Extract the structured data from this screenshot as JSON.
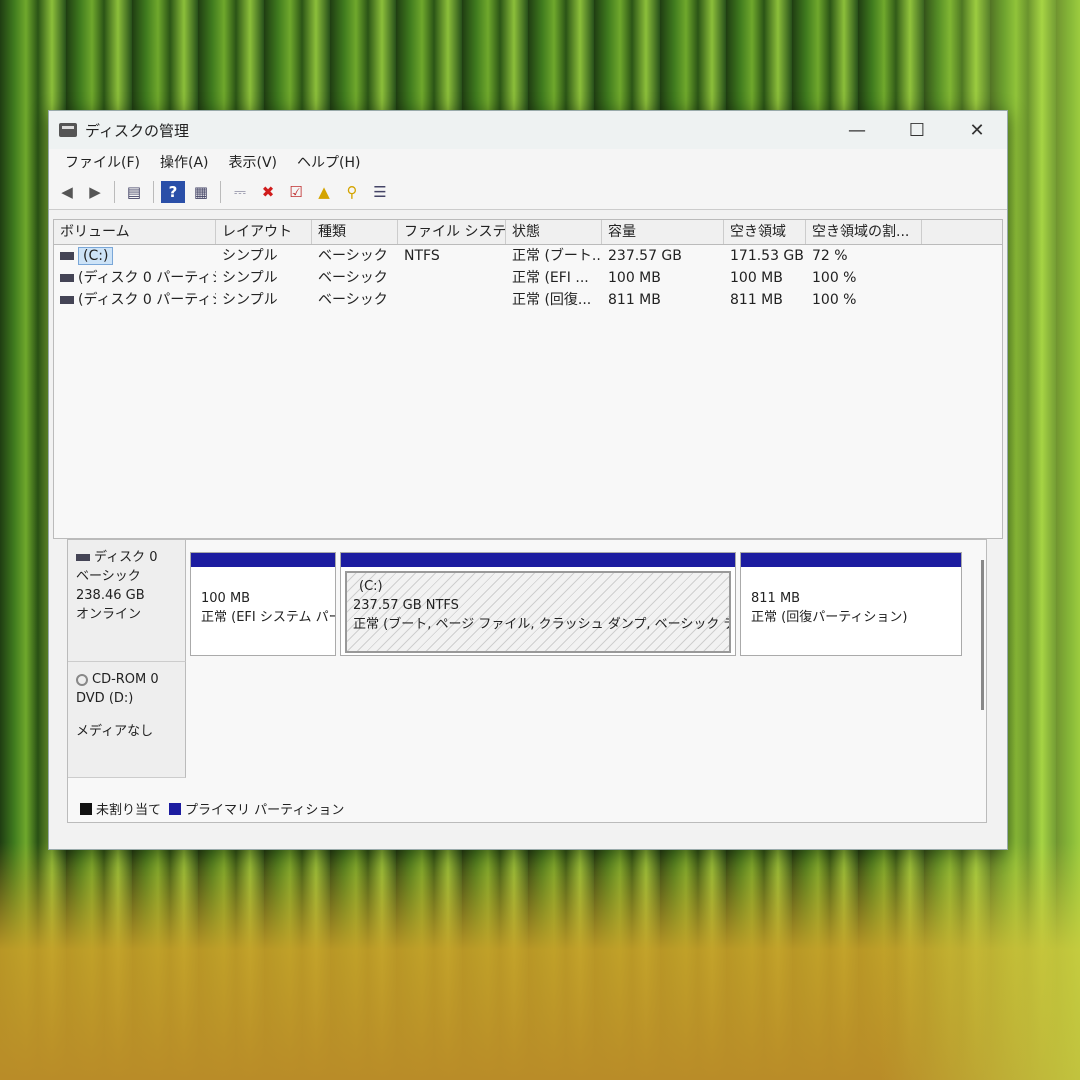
{
  "window": {
    "title": "ディスクの管理",
    "controls": {
      "minimize": "—",
      "maximize": "☐",
      "close": "✕"
    }
  },
  "menu": [
    "ファイル(F)",
    "操作(A)",
    "表示(V)",
    "ヘルプ(H)"
  ],
  "toolbar": {
    "icons": [
      "back-arrow-icon",
      "forward-arrow-icon",
      "console-tree-icon",
      "help-icon",
      "properties-icon",
      "connect-icon",
      "delete-icon",
      "check-icon",
      "export-icon",
      "search-icon",
      "list-icon"
    ]
  },
  "volumes": {
    "columns": [
      "ボリューム",
      "レイアウト",
      "種類",
      "ファイル システム",
      "状態",
      "容量",
      "空き領域",
      "空き領域の割..."
    ],
    "rows": [
      [
        "(C:)",
        "シンプル",
        "ベーシック",
        "NTFS",
        "正常 (ブート...",
        "237.57 GB",
        "171.53 GB",
        "72 %"
      ],
      [
        "(ディスク 0 パーティシ...",
        "シンプル",
        "ベーシック",
        "",
        "正常 (EFI ...",
        "100 MB",
        "100 MB",
        "100 %"
      ],
      [
        "(ディスク 0 パーティシ...",
        "シンプル",
        "ベーシック",
        "",
        "正常 (回復...",
        "811 MB",
        "811 MB",
        "100 %"
      ]
    ]
  },
  "disks": {
    "disk0": {
      "name": "ディスク 0",
      "type": "ベーシック",
      "size": "238.46 GB",
      "status": "オンライン",
      "partitions": [
        {
          "line1": "100 MB",
          "line2": "正常 (EFI システム パー"
        },
        {
          "line0": "(C:)",
          "line1": "237.57 GB NTFS",
          "line2": "正常 (ブート, ページ ファイル, クラッシュ ダンプ, ベーシック データ パーテ"
        },
        {
          "line1": "811 MB",
          "line2": "正常 (回復パーティション)"
        }
      ]
    },
    "cdrom0": {
      "name": "CD-ROM 0",
      "type": "DVD (D:)",
      "status": "メディアなし"
    }
  },
  "legend": {
    "unallocated": "未割り当て",
    "primary": "プライマリ パーティション",
    "colors": {
      "unallocated": "#111111",
      "primary": "#1c1ca0"
    }
  }
}
